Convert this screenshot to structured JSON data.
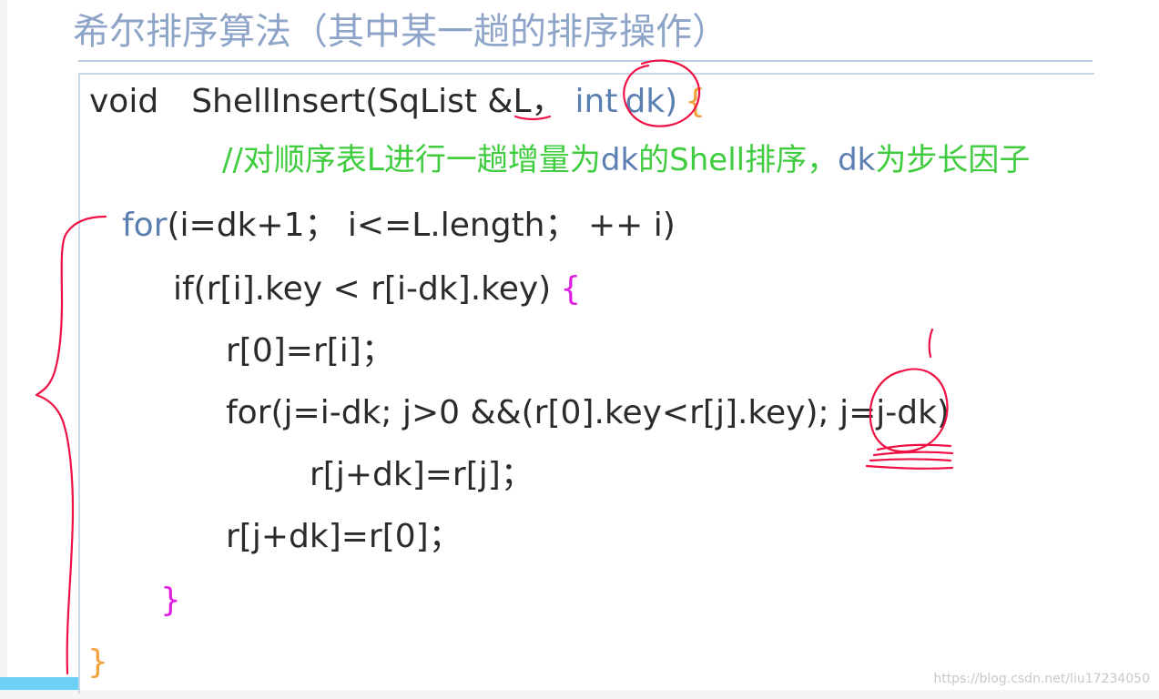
{
  "title": "希尔排序算法（其中某一趟的排序操作）",
  "code": {
    "line1": {
      "kw_void": "void",
      "fn": "ShellInsert(SqList &L，",
      "kw_int": "int",
      "param": "dk)",
      "brace": "{"
    },
    "comment": {
      "p1": "//对顺序表L进行一趟增量为",
      "dk1": "dk",
      "p2": "的Shell排序，",
      "dk2": "dk",
      "p3": "为步长因子"
    },
    "for1": {
      "kw": "for",
      "rest": "(i=dk+1； i<=L.length；  ++ i)"
    },
    "if1": {
      "text": "if(r[i].key < r[i-dk].key)",
      "brace": "{"
    },
    "assign1": "r[0]=r[i]；",
    "for2": "for(j=i-dk; j>0 &&(r[0].key<r[j].key); j=j-dk)",
    "assign2": "r[j+dk]=r[j]；",
    "assign3": "r[j+dk]=r[0]；",
    "close_if": "}",
    "close_fn": "}"
  },
  "watermark": "https://blog.csdn.net/liu17234050",
  "colors": {
    "title": "#8ea4c8",
    "keyword": "#5b7fb0",
    "comment": "#3fcc3f",
    "brace_orange": "#f2a23c",
    "brace_magenta": "#e020e0",
    "ink": "#ee1144"
  }
}
